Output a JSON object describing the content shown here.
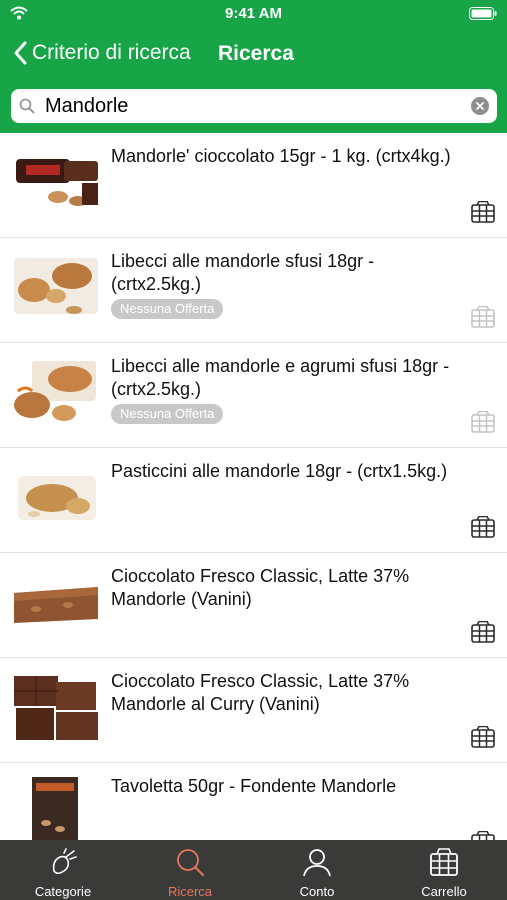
{
  "status": {
    "time": "9:41 AM"
  },
  "nav": {
    "back_label": "Criterio di ricerca",
    "title": "Ricerca"
  },
  "search": {
    "value": "Mandorle"
  },
  "products": [
    {
      "name": "Mandorle' cioccolato 15gr - 1 kg. (crtx4kg.)",
      "badge": "",
      "cart_enabled": true
    },
    {
      "name": "Libecci alle mandorle sfusi 18gr - (crtx2.5kg.)",
      "badge": "Nessuna Offerta",
      "cart_enabled": false
    },
    {
      "name": "Libecci alle mandorle e agrumi sfusi 18gr - (crtx2.5kg.)",
      "badge": "Nessuna Offerta",
      "cart_enabled": false
    },
    {
      "name": "Pasticcini alle mandorle 18gr - (crtx1.5kg.)",
      "badge": "",
      "cart_enabled": true
    },
    {
      "name": "Cioccolato Fresco Classic, Latte 37% Mandorle (Vanini)",
      "badge": "",
      "cart_enabled": true
    },
    {
      "name": "Cioccolato Fresco Classic, Latte 37% Mandorle al Curry (Vanini)",
      "badge": "",
      "cart_enabled": true
    },
    {
      "name": "Tavoletta 50gr - Fondente Mandorle",
      "badge": "",
      "cart_enabled": true
    }
  ],
  "tabs": [
    {
      "label": "Categorie",
      "icon": "categories-icon",
      "active": false
    },
    {
      "label": "Ricerca",
      "icon": "search-icon",
      "active": true
    },
    {
      "label": "Conto",
      "icon": "user-icon",
      "active": false
    },
    {
      "label": "Carrello",
      "icon": "cart-icon",
      "active": false
    }
  ],
  "colors": {
    "header": "#17a548",
    "tabbar": "#3a3a38",
    "active_tab": "#e8765e",
    "badge": "#c8c8c8"
  }
}
